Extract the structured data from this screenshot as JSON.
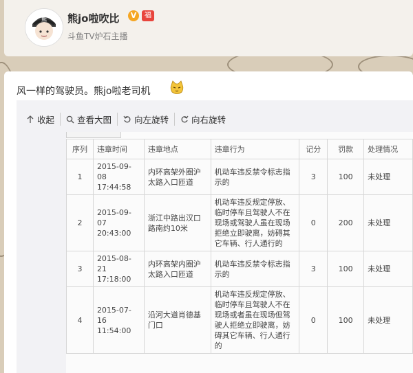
{
  "profile": {
    "username": "熊jo啦吹比",
    "verified_badge": "V",
    "badge_label": "福",
    "subtitle": "斗鱼TV炉石主播"
  },
  "post": {
    "text": "风一样的驾驶员。熊jo啦老司机",
    "emoji": "cat-face-icon"
  },
  "toolbar": {
    "collapse": "收起",
    "view_large": "查看大图",
    "rotate_left": "向左旋转",
    "rotate_right": "向右旋转"
  },
  "violations_table": {
    "headers": [
      "序列",
      "违章时间",
      "违章地点",
      "违章行为",
      "记分",
      "罚款",
      "处理情况"
    ],
    "rows": [
      {
        "seq": "1",
        "time": "2015-09-08 17:44:58",
        "place": "内环高架外圈沪太路入口匝道",
        "act": "机动车违反禁令标志指示的",
        "points": "3",
        "fine": "100",
        "status": "未处理"
      },
      {
        "seq": "2",
        "time": "2015-09-07 20:43:00",
        "place": "浙江中路出汉口路南约10米",
        "act": "机动车违反规定停放、临时停车且驾驶人不在现场或驾驶人虽在现场拒绝立即驶离，妨碍其它车辆、行人通行的",
        "points": "0",
        "fine": "200",
        "status": "未处理"
      },
      {
        "seq": "3",
        "time": "2015-08-21 17:18:00",
        "place": "内环高架内圈沪太路入口匝道",
        "act": "机动车违反禁令标志指示的",
        "points": "3",
        "fine": "100",
        "status": "未处理"
      },
      {
        "seq": "4",
        "time": "2015-07-16 11:54:00",
        "place": "沿河大道肖德基门口",
        "act": "机动车违反规定停放、临时停车且驾驶人不在现场或者虽在现场但驾驶人拒绝立即驶离，妨碍其它车辆、行人通行的",
        "points": "0",
        "fine": "100",
        "status": "未处理"
      }
    ]
  },
  "colors": {
    "page_bg": "#d9cdb9",
    "card_bg": "#ffffff",
    "viewer_bg": "#f2f2f5",
    "v_badge": "#f5a623",
    "text": "#333333"
  }
}
